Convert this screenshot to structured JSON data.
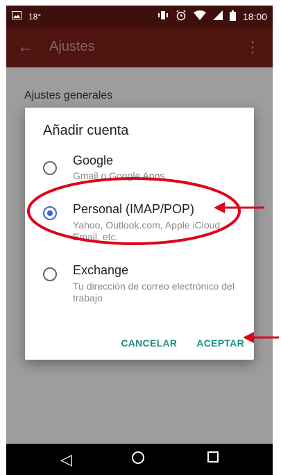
{
  "status_bar": {
    "temperature": "18°",
    "time": "18:00"
  },
  "app_bar": {
    "title": "Ajustes"
  },
  "settings": {
    "section_title": "Ajustes generales"
  },
  "dialog": {
    "title": "Añadir cuenta",
    "options": [
      {
        "title": "Google",
        "subtitle": "Gmail o Google Apps",
        "selected": false
      },
      {
        "title": "Personal (IMAP/POP)",
        "subtitle": "Yahoo, Outlook.com, Apple iCloud Email, etc.",
        "selected": true
      },
      {
        "title": "Exchange",
        "subtitle": "Tu dirección de correo electrónico del trabajo",
        "selected": false
      }
    ],
    "cancel_label": "CANCELAR",
    "accept_label": "ACEPTAR"
  },
  "colors": {
    "accent": "#3a63d6",
    "action": "#1a8f7d",
    "toolbar": "#7b1f19",
    "annotation": "#e0001a"
  }
}
